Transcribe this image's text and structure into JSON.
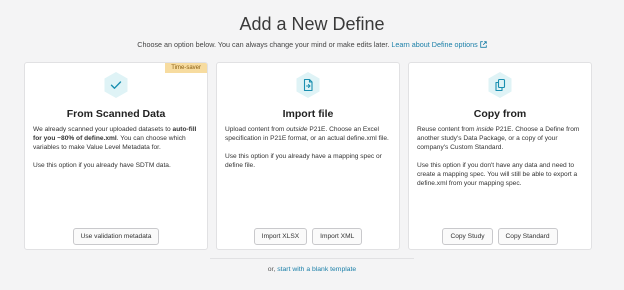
{
  "header": {
    "title": "Add a New Define",
    "subtitle_text": "Choose an option below. You can always change your mind or make edits later.",
    "learn_link": "Learn about Define options"
  },
  "cards": [
    {
      "badge": "Time-saver",
      "icon": "checkmark-icon",
      "title": "From Scanned Data",
      "desc_pre": "We already scanned your uploaded datasets to ",
      "desc_bold": "auto-fill for you ~80% of define.xml",
      "desc_post": ". You can choose which variables to make Value Level Metadata for.",
      "desc2": "Use this option if you already have SDTM data.",
      "buttons": [
        "Use validation metadata"
      ]
    },
    {
      "icon": "file-import-icon",
      "title": "Import file",
      "desc_pre": "Upload content from ",
      "desc_italic": "outside",
      "desc_post": " P21E. Choose an Excel specification in P21E format, or an actual define.xml file.",
      "desc2": "Use this option if you already have a mapping spec or define file.",
      "buttons": [
        "Import XLSX",
        "Import XML"
      ]
    },
    {
      "icon": "copy-icon",
      "title": "Copy from",
      "desc_pre": "Reuse content from ",
      "desc_italic": "inside",
      "desc_post": " P21E. Choose a Define from another study's Data Package, or a copy of your company's Custom Standard.",
      "desc2": "Use this option if you don't have any data and need to create a mapping spec. You will still be able to export a define.xml from your mapping spec.",
      "buttons": [
        "Copy Study",
        "Copy Standard"
      ]
    }
  ],
  "footer": {
    "prefix": "or, ",
    "link": "start with a blank template"
  },
  "colors": {
    "accent": "#1a7fa8",
    "hex_fill": "#dff3f6",
    "badge_bg": "#f7dca0"
  }
}
